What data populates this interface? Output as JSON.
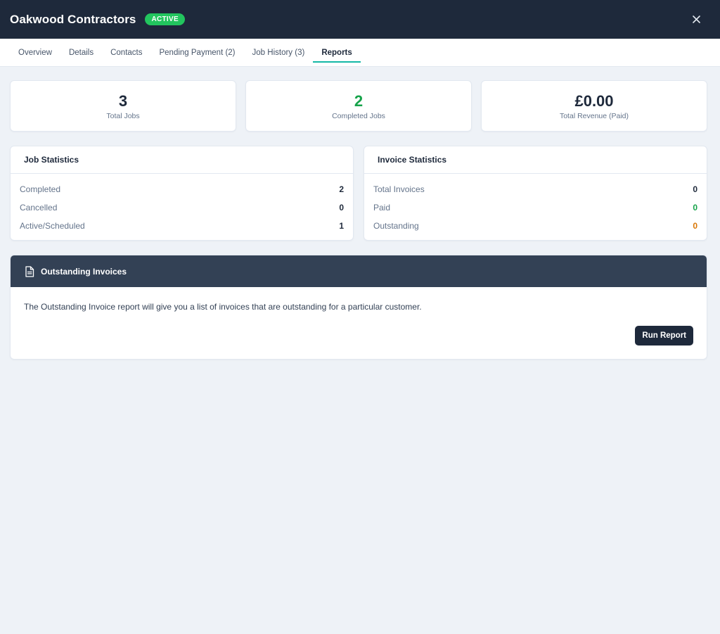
{
  "header": {
    "title": "Oakwood Contractors",
    "status_badge": "ACTIVE",
    "close_icon": "close-icon"
  },
  "tabs": [
    {
      "label": "Overview",
      "active": false
    },
    {
      "label": "Details",
      "active": false
    },
    {
      "label": "Contacts",
      "active": false
    },
    {
      "label": "Pending Payment (2)",
      "active": false
    },
    {
      "label": "Job History (3)",
      "active": false
    },
    {
      "label": "Reports",
      "active": true
    }
  ],
  "summary": [
    {
      "value": "3",
      "label": "Total Jobs"
    },
    {
      "value": "2",
      "label": "Completed Jobs"
    },
    {
      "value": "£0.00",
      "label": "Total Revenue (Paid)"
    }
  ],
  "job_statistics": {
    "title": "Job Statistics",
    "rows": [
      {
        "label": "Completed",
        "value": "2"
      },
      {
        "label": "Cancelled",
        "value": "0"
      },
      {
        "label": "Active/Scheduled",
        "value": "1"
      }
    ]
  },
  "invoice_statistics": {
    "title": "Invoice Statistics",
    "rows": [
      {
        "label": "Total Invoices",
        "value": "0"
      },
      {
        "label": "Paid",
        "value": "0"
      },
      {
        "label": "Outstanding",
        "value": "0"
      }
    ]
  },
  "outstanding_report": {
    "icon": "document-icon",
    "title": "Outstanding Invoices",
    "description": "The Outstanding Invoice report will give you a list of invoices that are outstanding for a particular customer.",
    "button_label": "Run Report"
  },
  "colors": {
    "header_bg": "#1e293b",
    "badge_green": "#22c55e",
    "tab_underline": "#14b8a6",
    "positive_green": "#16a34a",
    "warning_orange": "#d97706",
    "report_header_bg": "#334155"
  }
}
